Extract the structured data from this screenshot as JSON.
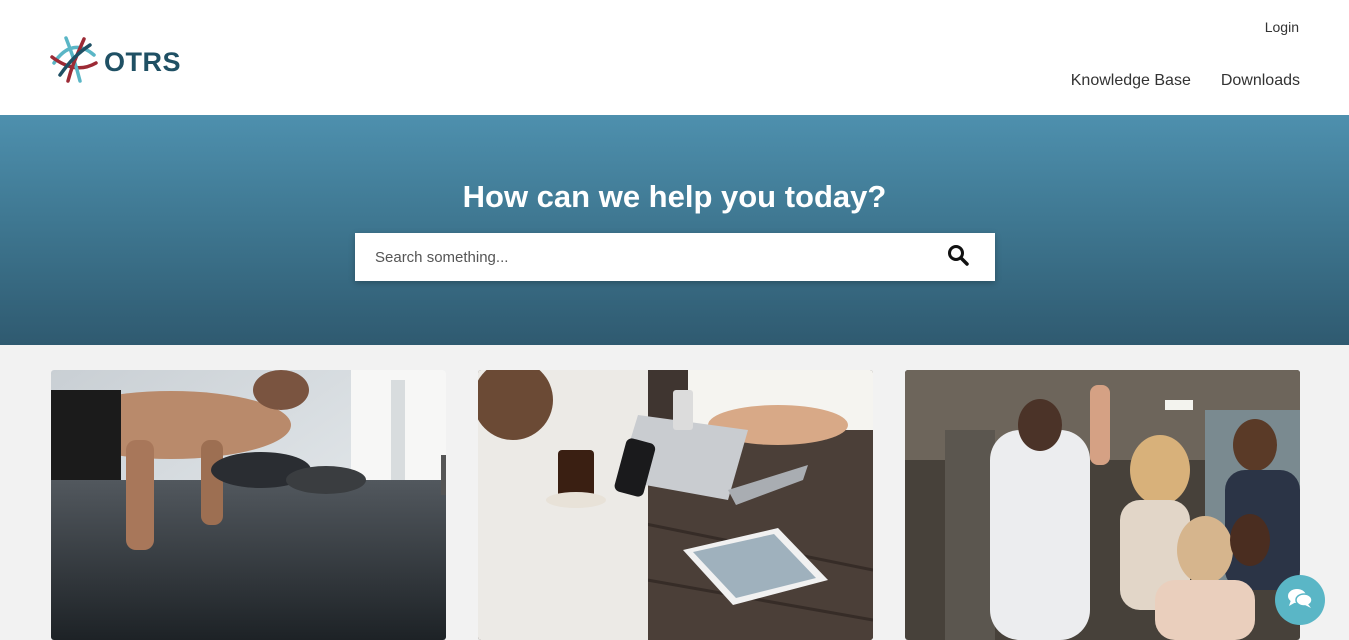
{
  "header": {
    "logo_text": "OTRS",
    "login_label": "Login",
    "nav": [
      {
        "label": "Knowledge Base"
      },
      {
        "label": "Downloads"
      }
    ]
  },
  "hero": {
    "title": "How can we help you today?",
    "search_placeholder": "Search something..."
  },
  "cards": [
    {
      "image": "people-doing-pushups-photo"
    },
    {
      "image": "cafe-laptop-phone-photo"
    },
    {
      "image": "team-high-five-office-photo"
    }
  ],
  "icons": {
    "logo": "otrs-logo-icon",
    "search": "search-icon",
    "chat": "chat-bubbles-icon"
  },
  "colors": {
    "brand": "#1f5064",
    "hero_top": "#4e90ae",
    "hero_bottom": "#2f5a70",
    "chat": "#5ab6c6"
  }
}
